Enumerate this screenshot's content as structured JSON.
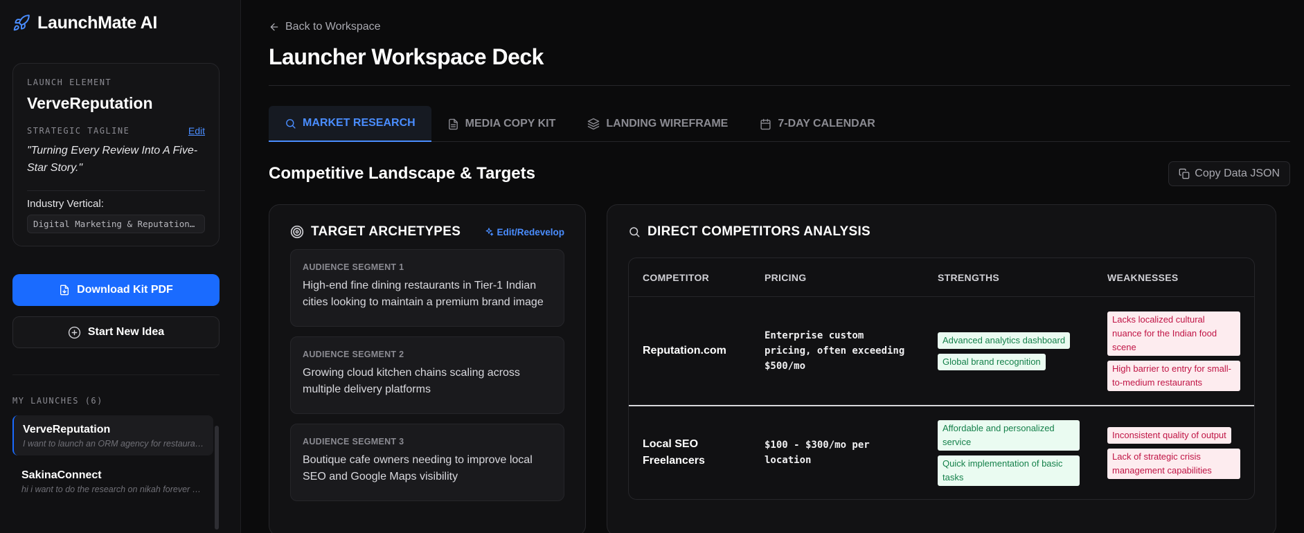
{
  "app": {
    "name": "LaunchMate AI"
  },
  "sidebar": {
    "element_label": "LAUNCH ELEMENT",
    "element_name": "VerveReputation",
    "tagline_label": "STRATEGIC TAGLINE",
    "tagline_edit": "Edit",
    "tagline": "\"Turning Every Review Into A Five-Star Story.\"",
    "industry_label": "Industry Vertical:",
    "industry_value": "Digital Marketing & Reputation Management",
    "download_btn": "Download Kit PDF",
    "new_idea_btn": "Start New Idea",
    "launches_label": "MY LAUNCHES (6)",
    "launches": [
      {
        "title": "VerveReputation",
        "desc": "I want to launch an ORM agency for restaurants",
        "active": true
      },
      {
        "title": "SakinaConnect",
        "desc": "hi i want to do the research on nikah forever and similar apps",
        "active": false
      }
    ]
  },
  "main": {
    "back_label": "Back to Workspace",
    "page_title": "Launcher Workspace Deck",
    "tabs": [
      {
        "label": "MARKET RESEARCH",
        "icon": "search-icon",
        "active": true
      },
      {
        "label": "MEDIA COPY KIT",
        "icon": "document-icon",
        "active": false
      },
      {
        "label": "LANDING WIREFRAME",
        "icon": "layers-icon",
        "active": false
      },
      {
        "label": "7-DAY CALENDAR",
        "icon": "calendar-icon",
        "active": false
      }
    ],
    "section_title": "Competitive Landscape & Targets",
    "copy_btn": "Copy Data JSON",
    "archetypes": {
      "title": "TARGET ARCHETYPES",
      "edit_label": "Edit/Redevelop",
      "segments": [
        {
          "label": "AUDIENCE SEGMENT 1",
          "text": "High-end fine dining restaurants in Tier-1 Indian cities looking to maintain a premium brand image"
        },
        {
          "label": "AUDIENCE SEGMENT 2",
          "text": "Growing cloud kitchen chains scaling across multiple delivery platforms"
        },
        {
          "label": "AUDIENCE SEGMENT 3",
          "text": "Boutique cafe owners needing to improve local SEO and Google Maps visibility"
        }
      ]
    },
    "competitors": {
      "title": "DIRECT COMPETITORS ANALYSIS",
      "headers": [
        "COMPETITOR",
        "PRICING",
        "STRENGTHS",
        "WEAKNESSES"
      ],
      "rows": [
        {
          "name": "Reputation.com",
          "pricing": "Enterprise custom pricing, often exceeding $500/mo",
          "strengths": [
            "Advanced analytics dashboard",
            "Global brand recognition"
          ],
          "weaknesses": [
            "Lacks localized cultural nuance for the Indian food scene",
            "High barrier to entry for small-to-medium restaurants"
          ]
        },
        {
          "name": "Local SEO Freelancers",
          "pricing": "$100 - $300/mo per location",
          "strengths": [
            "Affordable and personalized service",
            "Quick implementation of basic tasks"
          ],
          "weaknesses": [
            "Inconsistent quality of output",
            "Lack of strategic crisis management capabilities"
          ]
        }
      ]
    }
  },
  "colors": {
    "accent": "#1a6bff",
    "link": "#4a8dff",
    "strength_bg": "#eafbf1",
    "strength_fg": "#14804a",
    "weakness_bg": "#fdecef",
    "weakness_fg": "#c01445"
  }
}
